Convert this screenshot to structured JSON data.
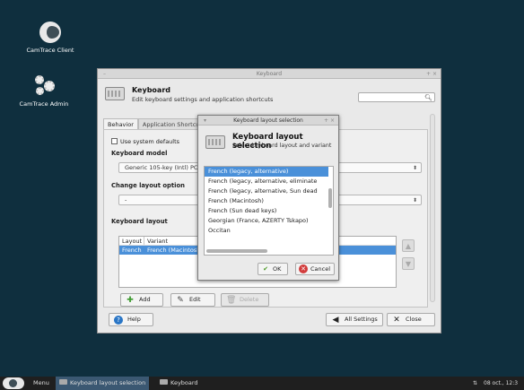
{
  "desktop": {
    "icons": [
      {
        "label": "CamTrace Client",
        "icon": "camtrace-logo-icon"
      },
      {
        "label": "CamTrace Admin",
        "icon": "gears-icon"
      }
    ]
  },
  "keyboard_window": {
    "title": "Keyboard",
    "header_title": "Keyboard",
    "header_subtitle": "Edit keyboard settings and application shortcuts",
    "tabs": [
      "Behavior",
      "Application Shortcu"
    ],
    "use_system_defaults": "Use system defaults",
    "keyboard_model_label": "Keyboard model",
    "keyboard_model_value": "Generic 105-key (Intl) PC",
    "change_layout_label": "Change layout option",
    "change_layout_value": "-",
    "keyboard_layout_label": "Keyboard layout",
    "layout_columns": [
      "Layout",
      "Variant"
    ],
    "layout_rows": [
      {
        "layout": "French",
        "variant": "French (Macintosh)"
      }
    ],
    "buttons": {
      "add": "Add",
      "edit": "Edit",
      "delete": "Delete",
      "help": "Help",
      "all_settings": "All Settings",
      "close": "Close"
    }
  },
  "dialog": {
    "title": "Keyboard layout selection",
    "header_title": "Keyboard layout selection",
    "header_subtitle": "Select keyboard layout and variant",
    "items": [
      "French (legacy, alternative)",
      "French (legacy, alternative, eliminate",
      "French (legacy, alternative, Sun dead",
      "French (Macintosh)",
      "French (Sun dead keys)",
      "Georgian (France, AZERTY Tskapo)",
      "Occitan"
    ],
    "selected_index": 0,
    "ok": "OK",
    "cancel": "Cancel"
  },
  "taskbar": {
    "menu": "Menu",
    "items": [
      "Keyboard layout selection",
      "Keyboard"
    ],
    "clock": "08 oct., 12:3"
  },
  "colors": {
    "accent": "#4a90d9",
    "desktop": "#0f2f3e",
    "taskbar": "#1f1f1f"
  }
}
